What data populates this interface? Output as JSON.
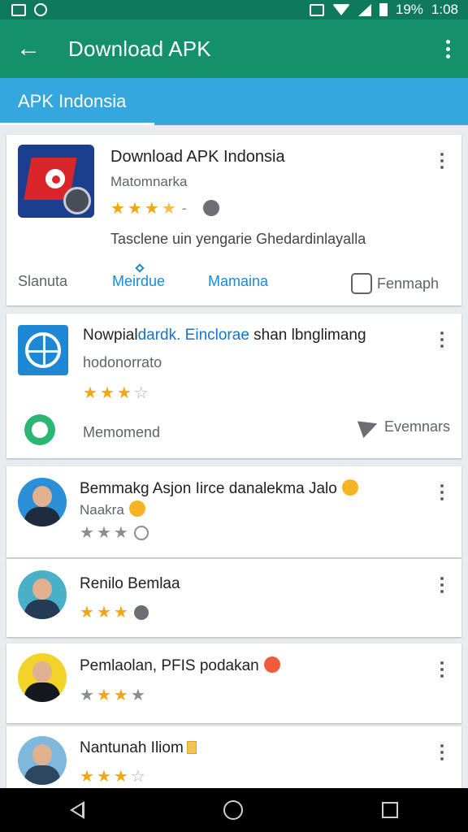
{
  "status_bar": {
    "battery_text": "19%",
    "time": "1:08"
  },
  "app_bar": {
    "title": "Download APK"
  },
  "tab": {
    "label": "APK Indonsia"
  },
  "app_card_1": {
    "title": "Download APK Indonsia",
    "developer": "Matomnarka",
    "rating": 3.5,
    "description": "Tasclene uin yengarie Ghedardinlayalla",
    "actions": [
      "Slanuta",
      "Meirdue",
      "Mamaina",
      "Fenmaph"
    ]
  },
  "app_card_2": {
    "title_prefix": "Nowpial",
    "title_link": "dardk. Einclorae",
    "title_suffix": " shan lbnglimang",
    "developer": "hodonorrato",
    "rating": 3,
    "action_left": "Memomend",
    "action_right": "Evemnars"
  },
  "reviews": [
    {
      "name": "Bemmakg Asjon Iirce danalekma Jalo",
      "sub": "Naakra",
      "rating": 3
    },
    {
      "name": "Renilo Bemlaa",
      "rating": 3
    },
    {
      "name": "Pemlaolan, PFIS podakan",
      "rating": 3
    },
    {
      "name": "Nantunah Iliom",
      "rating": 3
    }
  ],
  "colors": {
    "app_bar": "#14906a",
    "status_bar": "#0f7a5b",
    "tab_bar": "#33a7de",
    "star": "#f2a611",
    "link": "#1a8ad4"
  },
  "icons": {
    "back": "arrow-left",
    "overflow": "vertical-dots",
    "nav": [
      "back-triangle",
      "home-circle",
      "recent-square"
    ]
  }
}
